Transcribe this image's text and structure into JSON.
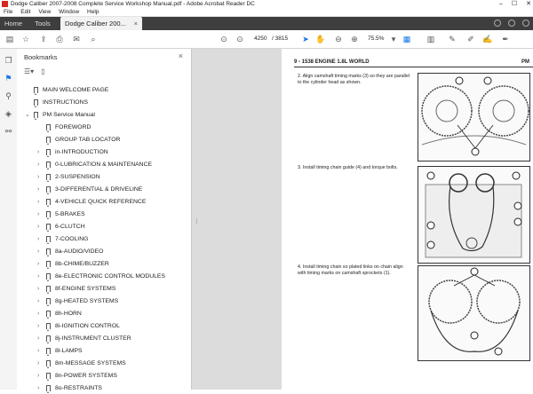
{
  "window": {
    "title": "Dodge Caliber 2007-2008 Complete Service Workshop Manual.pdf - Adobe Acrobat Reader DC",
    "controls": [
      "–",
      "☐",
      "✕"
    ]
  },
  "menu": [
    "File",
    "Edit",
    "View",
    "Window",
    "Help"
  ],
  "tabs": {
    "home": "Home",
    "tools": "Tools",
    "doc": "Dodge Caliber 200...",
    "close": "×"
  },
  "toolbar": {
    "current_page": "4250",
    "total_pages": "/ 3815",
    "zoom": "75.5%"
  },
  "bookmarks": {
    "header": "Bookmarks",
    "close": "×",
    "items": [
      {
        "label": "MAIN WELCOME PAGE",
        "level": 0,
        "expandable": false
      },
      {
        "label": "INSTRUCTIONS",
        "level": 0,
        "expandable": false
      },
      {
        "label": "PM Service Manual",
        "level": 0,
        "expandable": true,
        "expanded": true
      },
      {
        "label": "FOREWORD",
        "level": 1,
        "expandable": false
      },
      {
        "label": "GROUP TAB LOCATOR",
        "level": 1,
        "expandable": false
      },
      {
        "label": "in-INTRODUCTION",
        "level": 1,
        "expandable": true
      },
      {
        "label": "0-LUBRICATION & MAINTENANCE",
        "level": 1,
        "expandable": true
      },
      {
        "label": "2-SUSPENSION",
        "level": 1,
        "expandable": true
      },
      {
        "label": "3-DIFFERENTIAL & DRIVELINE",
        "level": 1,
        "expandable": true
      },
      {
        "label": "4-VEHICLE QUICK REFERENCE",
        "level": 1,
        "expandable": true
      },
      {
        "label": "5-BRAKES",
        "level": 1,
        "expandable": true
      },
      {
        "label": "6-CLUTCH",
        "level": 1,
        "expandable": true
      },
      {
        "label": "7-COOLING",
        "level": 1,
        "expandable": true
      },
      {
        "label": "8a-AUDIO/VIDEO",
        "level": 1,
        "expandable": true
      },
      {
        "label": "8b-CHIME/BUZZER",
        "level": 1,
        "expandable": true
      },
      {
        "label": "8e-ELECTRONIC CONTROL MODULES",
        "level": 1,
        "expandable": true
      },
      {
        "label": "8f-ENGINE SYSTEMS",
        "level": 1,
        "expandable": true
      },
      {
        "label": "8g-HEATED SYSTEMS",
        "level": 1,
        "expandable": true
      },
      {
        "label": "8h-HORN",
        "level": 1,
        "expandable": true
      },
      {
        "label": "8i-IGNITION CONTROL",
        "level": 1,
        "expandable": true
      },
      {
        "label": "8j-INSTRUMENT CLUSTER",
        "level": 1,
        "expandable": true
      },
      {
        "label": "8l-LAMPS",
        "level": 1,
        "expandable": true
      },
      {
        "label": "8m-MESSAGE SYSTEMS",
        "level": 1,
        "expandable": true
      },
      {
        "label": "8n-POWER SYSTEMS",
        "level": 1,
        "expandable": true
      },
      {
        "label": "8o-RESTRAINTS",
        "level": 1,
        "expandable": true
      }
    ]
  },
  "page": {
    "header_left": "9 - 1538     ENGINE 1.8L WORLD",
    "header_right": "PM",
    "steps": [
      "2.  Align camshaft timing marks (3) so they are parallel to the cylinder head as shown.",
      "3.  Install timing chain guide (4) and torque bolts.",
      "4.  Install timing chain so plated links on chain align with timing marks on camshaft sprockets (1)."
    ]
  }
}
